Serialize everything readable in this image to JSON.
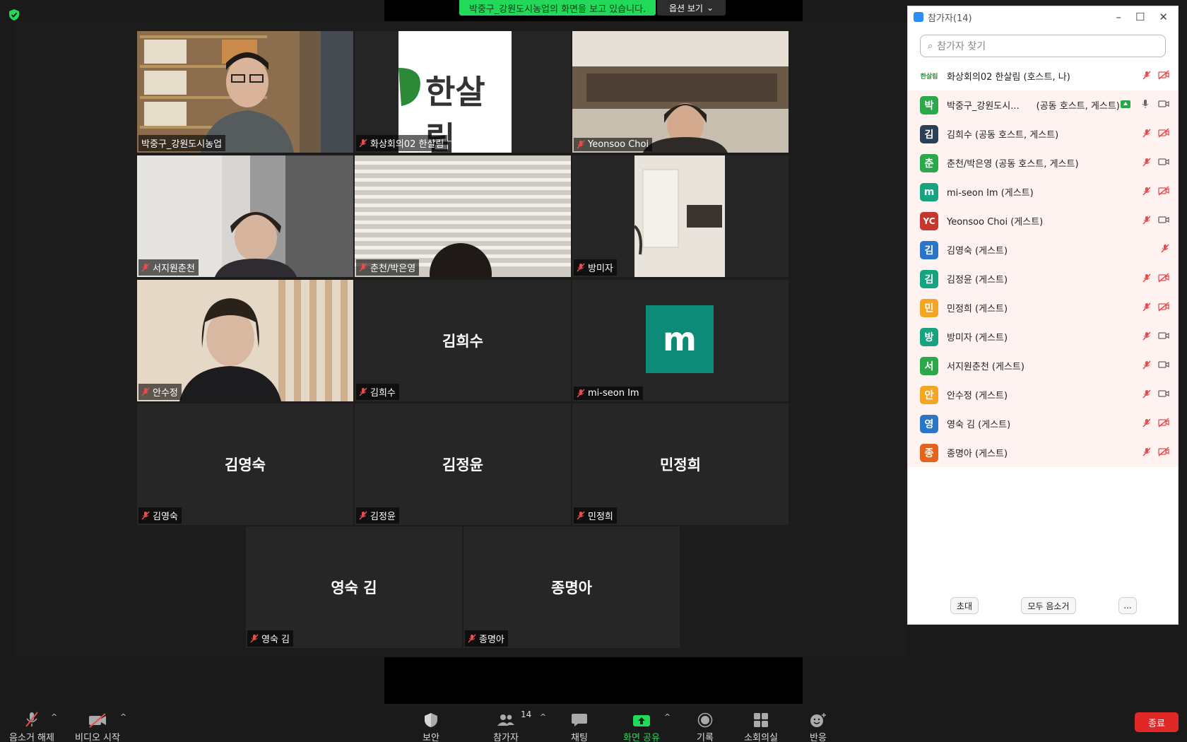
{
  "share": {
    "banner_text": "박중구_강원도시농업의 화면을 보고 있습니다.",
    "options_label": "옵션 보기"
  },
  "tiles": [
    {
      "label": "박중구_강원도시농업"
    },
    {
      "label": "화상회의02 한살림",
      "logo_text": "한살림"
    },
    {
      "label": "Yeonsoo Choi"
    },
    {
      "label": "서지원춘천"
    },
    {
      "label": "춘천/박은영"
    },
    {
      "label": "방미자"
    },
    {
      "label": "안수정"
    },
    {
      "label": "김희수",
      "name": "김희수"
    },
    {
      "label": "mi-seon Im",
      "avatar_letter": "m"
    },
    {
      "label": "김영숙",
      "name": "김영숙"
    },
    {
      "label": "김정윤",
      "name": "김정윤"
    },
    {
      "label": "민정희",
      "name": "민정희"
    },
    {
      "label": "영숙 김",
      "name": "영숙 김"
    },
    {
      "label": "종명아",
      "name": "종명아"
    }
  ],
  "panel": {
    "title": "참가자(14)",
    "search_placeholder": "참가자 찾기",
    "participants": [
      {
        "avatar": "한살림",
        "color": "#ffffff",
        "name": "화상회의02 한살림 (호스트, 나)"
      },
      {
        "avatar": "박",
        "color": "#2aa84a",
        "name": "박중구_강원도시...",
        "role": "(공동 호스트, 게스트)"
      },
      {
        "avatar": "김",
        "color": "#2d3f57",
        "name": "김희수 (공동 호스트, 게스트)"
      },
      {
        "avatar": "춘",
        "color": "#2aa84a",
        "name": "춘천/박은영 (공동 호스트, 게스트)"
      },
      {
        "avatar": "m",
        "color": "#16a37f",
        "name": "mi-seon Im (게스트)"
      },
      {
        "avatar": "YC",
        "color": "#c8352c",
        "name": "Yeonsoo Choi (게스트)"
      },
      {
        "avatar": "김",
        "color": "#2a75c8",
        "name": "김영숙 (게스트)"
      },
      {
        "avatar": "김",
        "color": "#16a37f",
        "name": "김정윤 (게스트)"
      },
      {
        "avatar": "민",
        "color": "#f5a524",
        "name": "민정희 (게스트)"
      },
      {
        "avatar": "방",
        "color": "#16a37f",
        "name": "방미자 (게스트)"
      },
      {
        "avatar": "서",
        "color": "#2aa84a",
        "name": "서지원춘천 (게스트)"
      },
      {
        "avatar": "안",
        "color": "#f5a524",
        "name": "안수정 (게스트)"
      },
      {
        "avatar": "영",
        "color": "#2a75c8",
        "name": "영숙 김 (게스트)"
      },
      {
        "avatar": "종",
        "color": "#e5631a",
        "name": "종명아 (게스트)"
      }
    ],
    "footer": {
      "invite": "초대",
      "mute_all": "모두 음소거",
      "more": "..."
    }
  },
  "toolbar": {
    "unmute": "음소거 해제",
    "start_video": "비디오 시작",
    "security": "보안",
    "participants": "참가자",
    "participants_count": "14",
    "chat": "채팅",
    "share": "화면 공유",
    "record": "기록",
    "breakout": "소회의실",
    "reactions": "반응",
    "end": "종료"
  }
}
